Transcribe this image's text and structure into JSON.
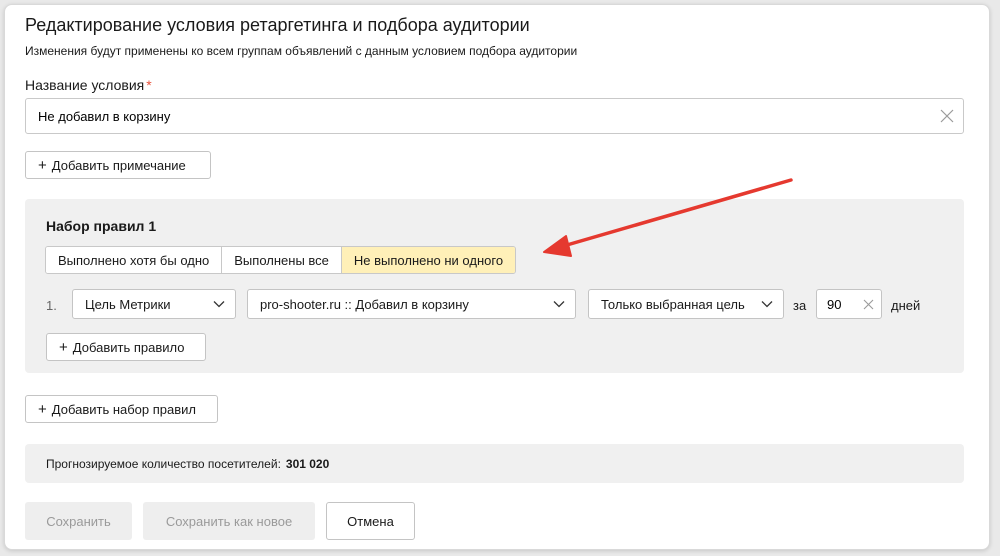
{
  "dialog": {
    "title": "Редактирование условия ретаргетинга и подбора аудитории",
    "subtitle": "Изменения будут применены ко всем группам объявлений с данным условием подбора аудитории"
  },
  "name_field": {
    "label": "Название условия",
    "required_mark": "*",
    "value": "Не добавил в корзину"
  },
  "add_note_button": {
    "icon": "plus-icon",
    "label": "Добавить примечание"
  },
  "ruleset": {
    "title": "Набор правил 1",
    "options": [
      {
        "label": "Выполнено хотя бы одно",
        "selected": false
      },
      {
        "label": "Выполнены все",
        "selected": false
      },
      {
        "label": "Не выполнено ни одного",
        "selected": true
      }
    ],
    "rule": {
      "number": "1.",
      "goal_type": "Цель Метрики",
      "goal": "pro-shooter.ru :: Добавил в корзину",
      "mode": "Только выбранная цель",
      "period_prefix": "за",
      "days_value": "90",
      "period_suffix": "дней"
    },
    "add_rule_label": "Добавить правило"
  },
  "add_ruleset_label": "Добавить набор правил",
  "forecast": {
    "label": "Прогнозируемое количество посетителей:",
    "value": "301 020"
  },
  "footer": {
    "save_label": "Сохранить",
    "save_new_label": "Сохранить как новое",
    "cancel_label": "Отмена"
  },
  "colors": {
    "selected_option_bg": "#fff0b8",
    "panel_bg": "#f0f0f0",
    "required_mark": "#e8533d",
    "annotation_arrow": "#e5392f"
  }
}
